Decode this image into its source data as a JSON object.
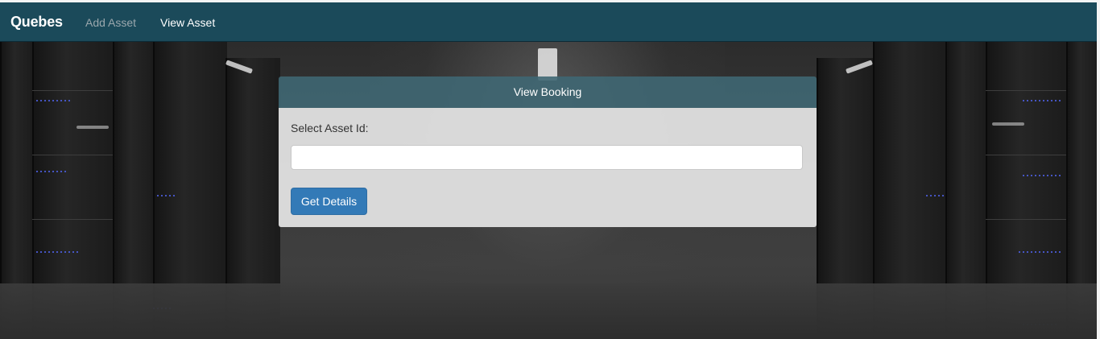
{
  "navbar": {
    "brand": "Quebes",
    "links": [
      {
        "label": "Add Asset"
      },
      {
        "label": "View Asset"
      }
    ]
  },
  "panel": {
    "heading": "View Booking",
    "field_label": "Select Asset Id:",
    "input_value": "",
    "button_label": "Get Details"
  },
  "colors": {
    "navbar_bg": "#1b4a5a",
    "panel_heading_bg": "#3f6773",
    "button_bg": "#337ab7"
  }
}
